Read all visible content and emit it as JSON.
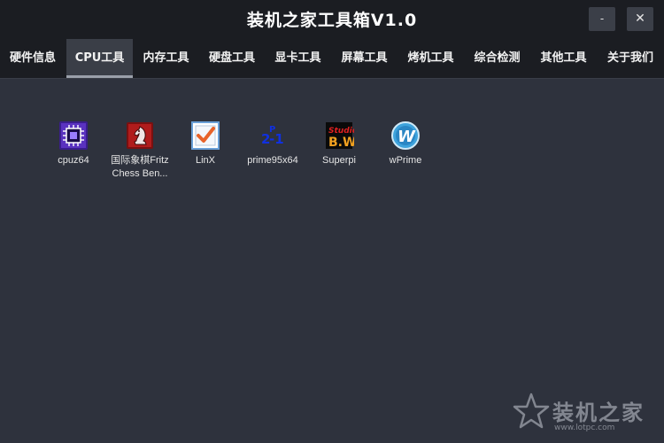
{
  "window": {
    "title": "装机之家工具箱V1.0",
    "minimize_label": "-",
    "close_label": "✕"
  },
  "tabs": [
    {
      "label": "硬件信息",
      "active": false
    },
    {
      "label": "CPU工具",
      "active": true
    },
    {
      "label": "内存工具",
      "active": false
    },
    {
      "label": "硬盘工具",
      "active": false
    },
    {
      "label": "显卡工具",
      "active": false
    },
    {
      "label": "屏幕工具",
      "active": false
    },
    {
      "label": "烤机工具",
      "active": false
    },
    {
      "label": "综合检测",
      "active": false
    },
    {
      "label": "其他工具",
      "active": false
    },
    {
      "label": "关于我们",
      "active": false
    }
  ],
  "apps": [
    {
      "label": "cpuz64",
      "icon": "cpuz-icon"
    },
    {
      "label": "国际象棋Fritz Chess Ben...",
      "icon": "fritz-chess-icon"
    },
    {
      "label": "LinX",
      "icon": "linx-icon"
    },
    {
      "label": "prime95x64",
      "icon": "prime95-icon"
    },
    {
      "label": "Superpi",
      "icon": "superpi-icon"
    },
    {
      "label": "wPrime",
      "icon": "wprime-icon"
    }
  ],
  "watermark": {
    "text": "装机之家",
    "url": "www.lotpc.com"
  },
  "colors": {
    "background": "#2e323d",
    "titlebar": "#1b1d22",
    "active_tab": "#3a3e47"
  }
}
